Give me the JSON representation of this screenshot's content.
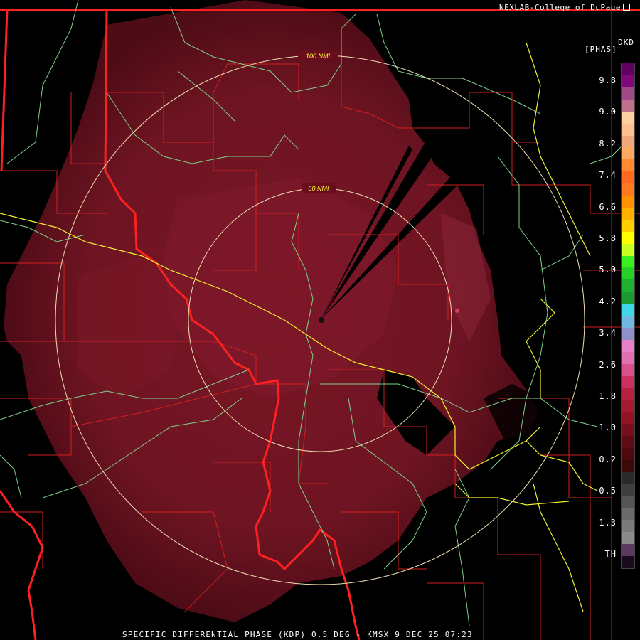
{
  "header": {
    "credit": "NEXLAB-College of DuPage"
  },
  "footer": {
    "product_line": "SPECIFIC DIFFERENTIAL PHASE (KDP) 0.5 DEG - KMSX 9 DEC 25 07:23"
  },
  "legend": {
    "product_code": "DKD",
    "units": "[PHAS]",
    "ticks": [
      "9.8",
      "9.0",
      "8.2",
      "7.4",
      "6.6",
      "5.8",
      "5.0",
      "4.2",
      "3.4",
      "2.6",
      "1.8",
      "1.0",
      "0.2",
      "-0.5",
      "-1.3",
      "TH"
    ],
    "colors": [
      "#1a0a1e",
      "#5a3a5e",
      "#8a8a8a",
      "#7a7a7a",
      "#6a6a6a",
      "#555",
      "#3e3e3e",
      "#2a2a2a",
      "#3a0a0a",
      "#4e0810",
      "#5e0c18",
      "#760e1e",
      "#901424",
      "#a41a30",
      "#b82040",
      "#cc3060",
      "#d8508c",
      "#e070b0",
      "#e880c8",
      "#9090c8",
      "#70b8e0",
      "#40d8e8",
      "#1a9a30",
      "#20b030",
      "#28d028",
      "#38f020",
      "#c8ff20",
      "#ffff00",
      "#ffd000",
      "#ffb000",
      "#ff9000",
      "#ff7820",
      "#ff6820",
      "#ff8a30",
      "#ffa860",
      "#f0a878",
      "#ffc090",
      "#ffd0a0",
      "#c07088",
      "#a04888",
      "#800878",
      "#600060"
    ]
  },
  "range_rings": [
    {
      "label": "50 NMI"
    },
    {
      "label": "100 NMI"
    }
  ],
  "colors": {
    "echo_base": "#66101c",
    "echo_mid": "#7a1626",
    "echo_light": "#8c2034",
    "county": "#d02020",
    "state": "#ff2020",
    "river": "#7fd08a",
    "road": "#f2f230",
    "ring": "#f0e0b0"
  }
}
